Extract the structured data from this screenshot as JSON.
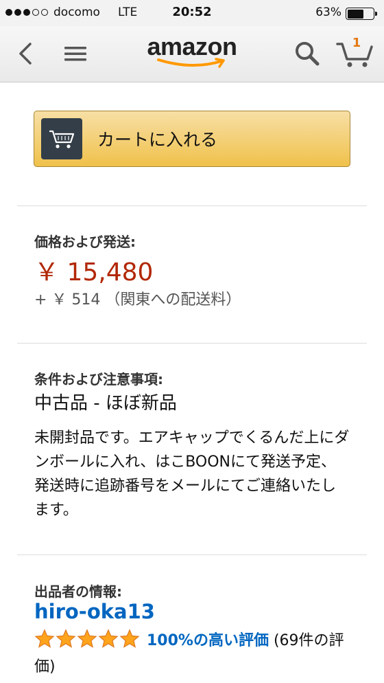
{
  "status_bar": {
    "carrier": "docomo",
    "network": "LTE",
    "time": "20:52",
    "battery": "63%",
    "battery_level": 0.63
  },
  "nav": {
    "logo": "amazon",
    "cart_count": "1",
    "icons": [
      "back-arrow-icon",
      "menu-icon",
      "amazon-logo",
      "search-icon",
      "cart-icon"
    ],
    "accent_color": "#ff9900"
  },
  "add_to_cart": {
    "label": "カートに入れる",
    "icon": "cart-icon",
    "color": "#f0c14b"
  },
  "price_section": {
    "title": "価格および発送:",
    "price": "￥ 15,480",
    "shipping": "+ ￥ 514 （関東への配送料）",
    "price_color": "#b12704"
  },
  "condition_section": {
    "title": "条件および注意事項:",
    "condition": "中古品 - ほぼ新品",
    "note": "未開封品です。エアキャップでくるんだ上にダンボールに入れ、はこBOONにて発送予定、発送時に追跡番号をメールにてご連絡いたします。"
  },
  "seller_section": {
    "title": "出品者の情報:",
    "seller_name": "hiro-oka13",
    "stars": 5,
    "rating_link": "100%の高い評価",
    "rating_count": "(69件の評価)",
    "link_color": "#0066c0"
  }
}
